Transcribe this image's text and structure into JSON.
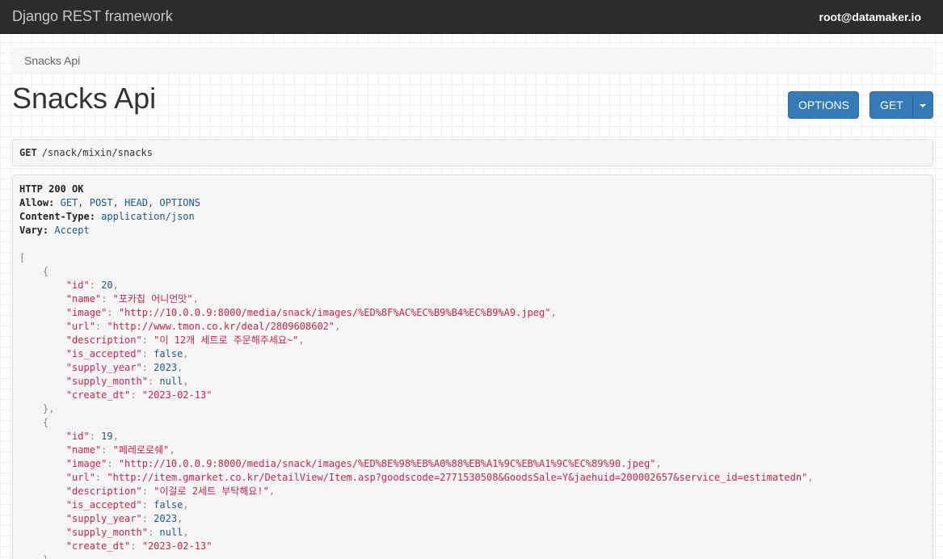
{
  "navbar": {
    "brand": "Django REST framework",
    "user": "root@datamaker.io"
  },
  "breadcrumb": {
    "current": "Snacks Api"
  },
  "page": {
    "title": "Snacks Api",
    "options_button": "OPTIONS",
    "get_button": "GET"
  },
  "request": {
    "method": "GET",
    "path": "/snack/mixin/snacks"
  },
  "response": {
    "status": "HTTP 200 OK",
    "headers": [
      {
        "name": "Allow:",
        "value": "GET, POST, HEAD, OPTIONS"
      },
      {
        "name": "Content-Type:",
        "value": "application/json"
      },
      {
        "name": "Vary:",
        "value": "Accept"
      }
    ],
    "items": [
      {
        "id": "20",
        "name": "\"포카칩 어니언맛\"",
        "image": "\"http://10.0.0.9:8000/media/snack/images/%ED%8F%AC%EC%B9%B4%EC%B9%A9.jpeg\"",
        "url": "\"http://www.tmon.co.kr/deal/2809608602\"",
        "description": "\"이 12개 세트로 주문해주세요~\"",
        "is_accepted": "false",
        "supply_year": "2023",
        "supply_month": "null",
        "create_dt": "\"2023-02-13\""
      },
      {
        "id": "19",
        "name": "\"페레로로쉐\"",
        "image": "\"http://10.0.0.9:8000/media/snack/images/%ED%8E%98%EB%A0%88%EB%A1%9C%EB%A1%9C%EC%89%90.jpeg\"",
        "url": "\"http://item.gmarket.co.kr/DetailView/Item.asp?goodscode=2771530508&GoodsSale=Y&jaehuid=200002657&service_id=estimatedn\"",
        "description": "\"이걸로 2세트 부탁해요!\"",
        "is_accepted": "false",
        "supply_year": "2023",
        "supply_month": "null",
        "create_dt": "\"2023-02-13\""
      }
    ]
  }
}
